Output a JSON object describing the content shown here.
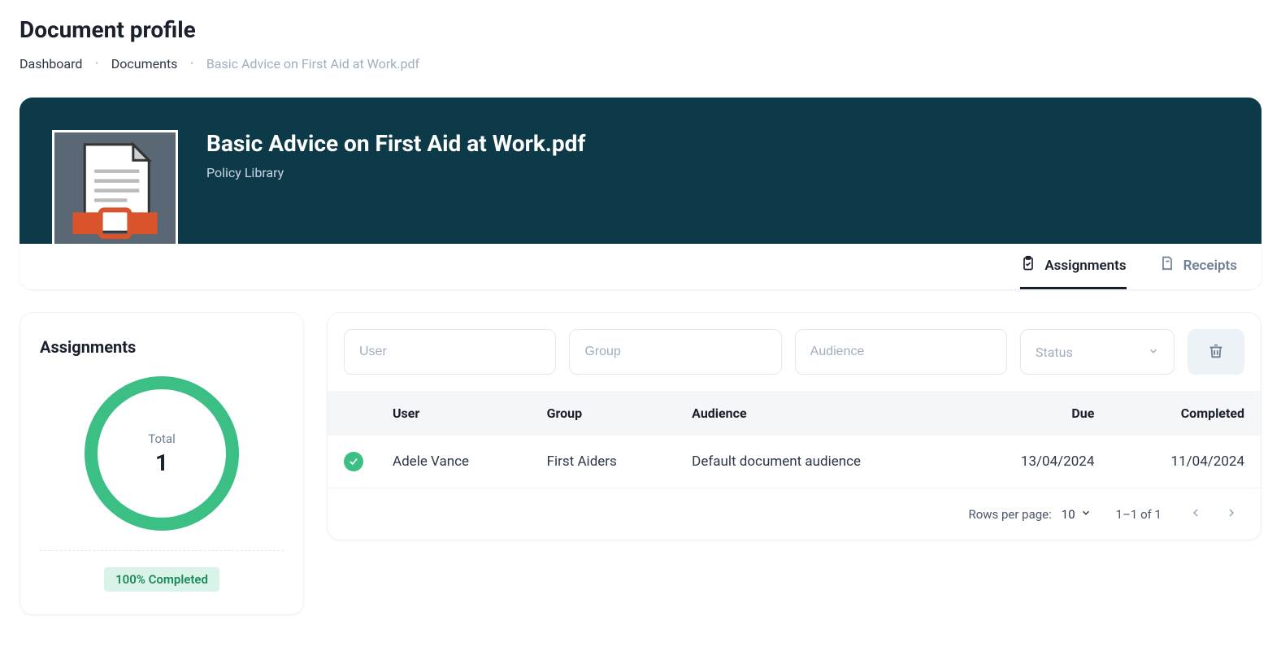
{
  "page_title": "Document profile",
  "breadcrumb": {
    "items": [
      "Dashboard",
      "Documents"
    ],
    "current": "Basic Advice on First Aid at Work.pdf"
  },
  "hero": {
    "title": "Basic Advice on First Aid at Work.pdf",
    "subtitle": "Policy Library"
  },
  "tabs": {
    "assignments": "Assignments",
    "receipts": "Receipts",
    "active": "assignments"
  },
  "sidebar": {
    "title": "Assignments",
    "total_label": "Total",
    "total_value": "1",
    "completion_badge": "100% Completed"
  },
  "filters": {
    "user_placeholder": "User",
    "group_placeholder": "Group",
    "audience_placeholder": "Audience",
    "status_label": "Status"
  },
  "table": {
    "headers": {
      "user": "User",
      "group": "Group",
      "audience": "Audience",
      "due": "Due",
      "completed": "Completed"
    },
    "rows": [
      {
        "status": "complete",
        "user": "Adele Vance",
        "group": "First Aiders",
        "audience": "Default document audience",
        "due": "13/04/2024",
        "completed": "11/04/2024"
      }
    ]
  },
  "pagination": {
    "rows_per_page_label": "Rows per page:",
    "rows_per_page_value": "10",
    "range": "1–1 of 1"
  },
  "chart_data": {
    "type": "pie",
    "title": "Assignments",
    "categories": [
      "Completed"
    ],
    "values": [
      1
    ],
    "total": 1,
    "percent_completed": 100
  }
}
